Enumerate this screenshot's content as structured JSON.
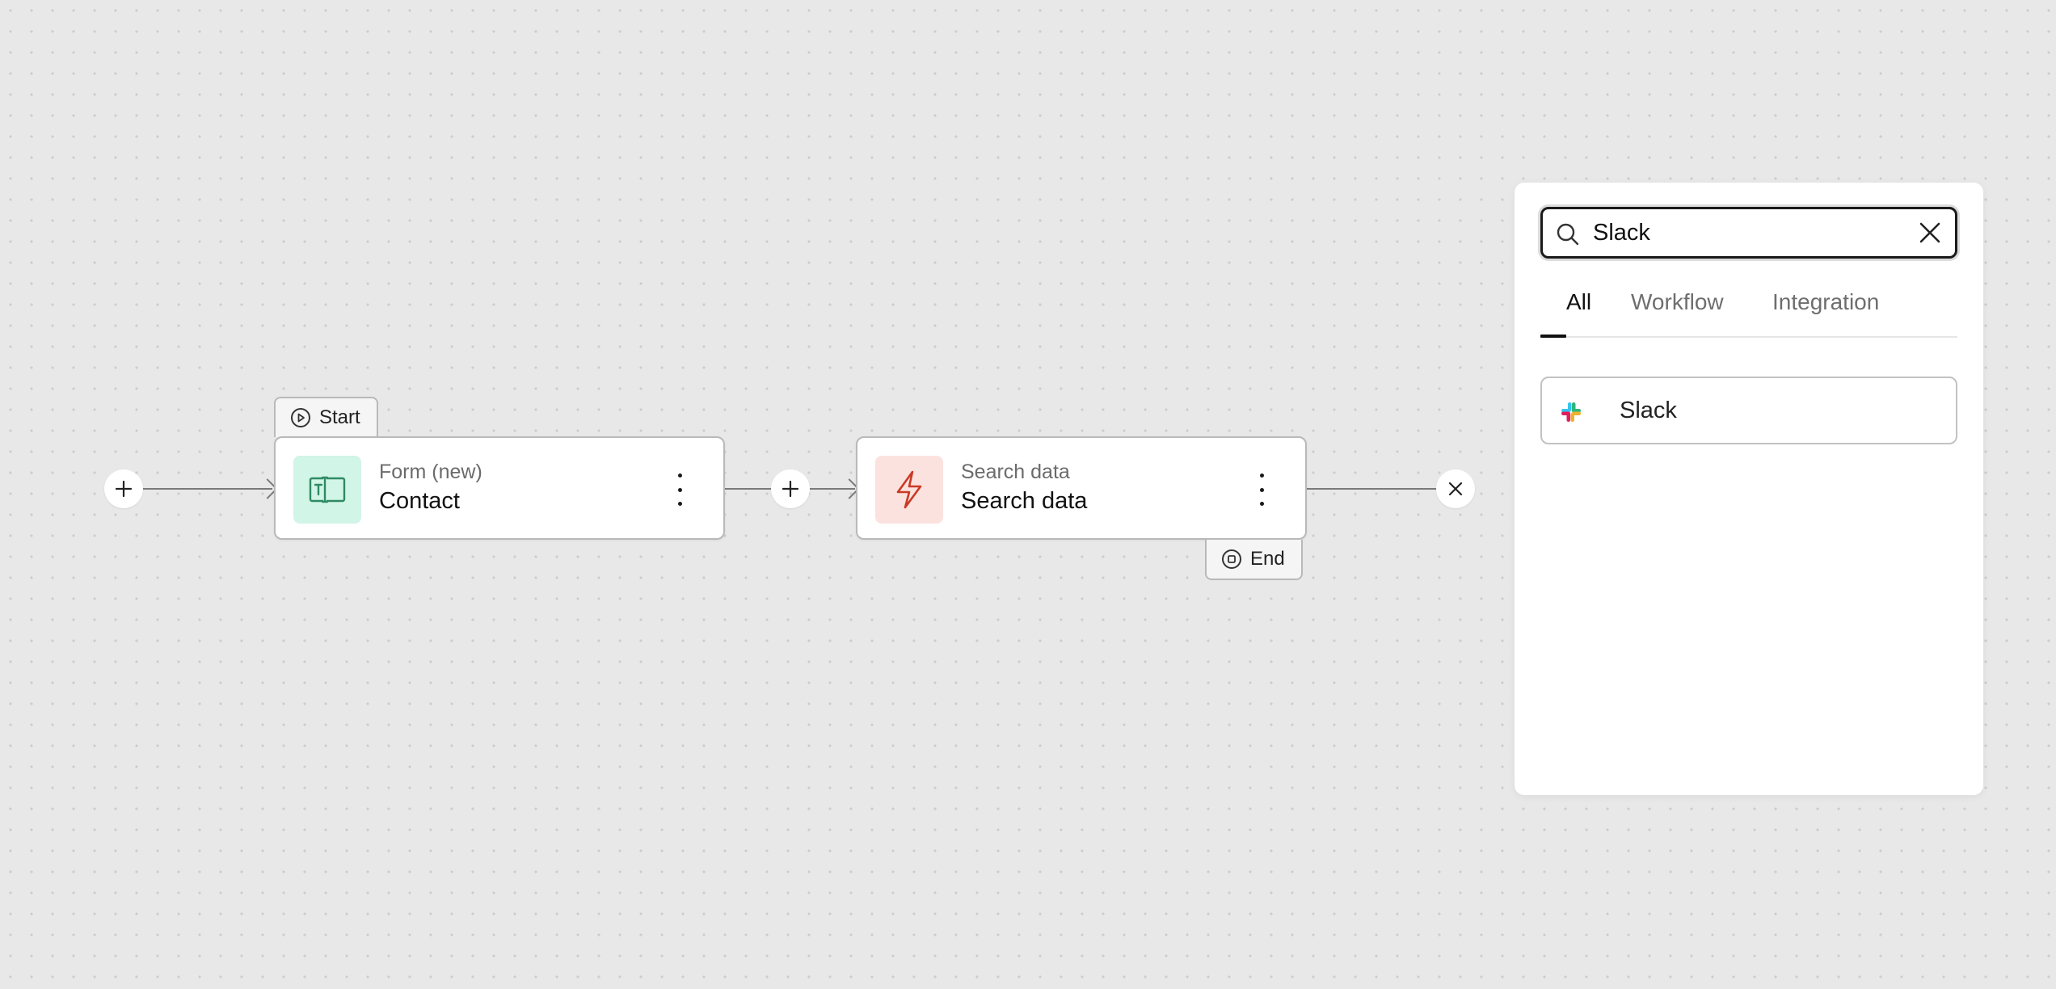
{
  "workflow": {
    "start_tag": "Start",
    "end_tag": "End",
    "nodes": [
      {
        "type": "Form (new)",
        "title": "Contact",
        "icon": "form-icon",
        "icon_bg": "#d1f5e6",
        "icon_color": "#2f8a64"
      },
      {
        "type": "Search data",
        "title": "Search data",
        "icon": "lightning-icon",
        "icon_bg": "#fbe2de",
        "icon_color": "#c93a26"
      }
    ]
  },
  "search_panel": {
    "query": "Slack",
    "tabs": [
      {
        "label": "All",
        "active": true
      },
      {
        "label": "Workflow",
        "active": false
      },
      {
        "label": "Integration",
        "active": false
      }
    ],
    "results": [
      {
        "label": "Slack",
        "icon": "slack-logo"
      }
    ]
  }
}
